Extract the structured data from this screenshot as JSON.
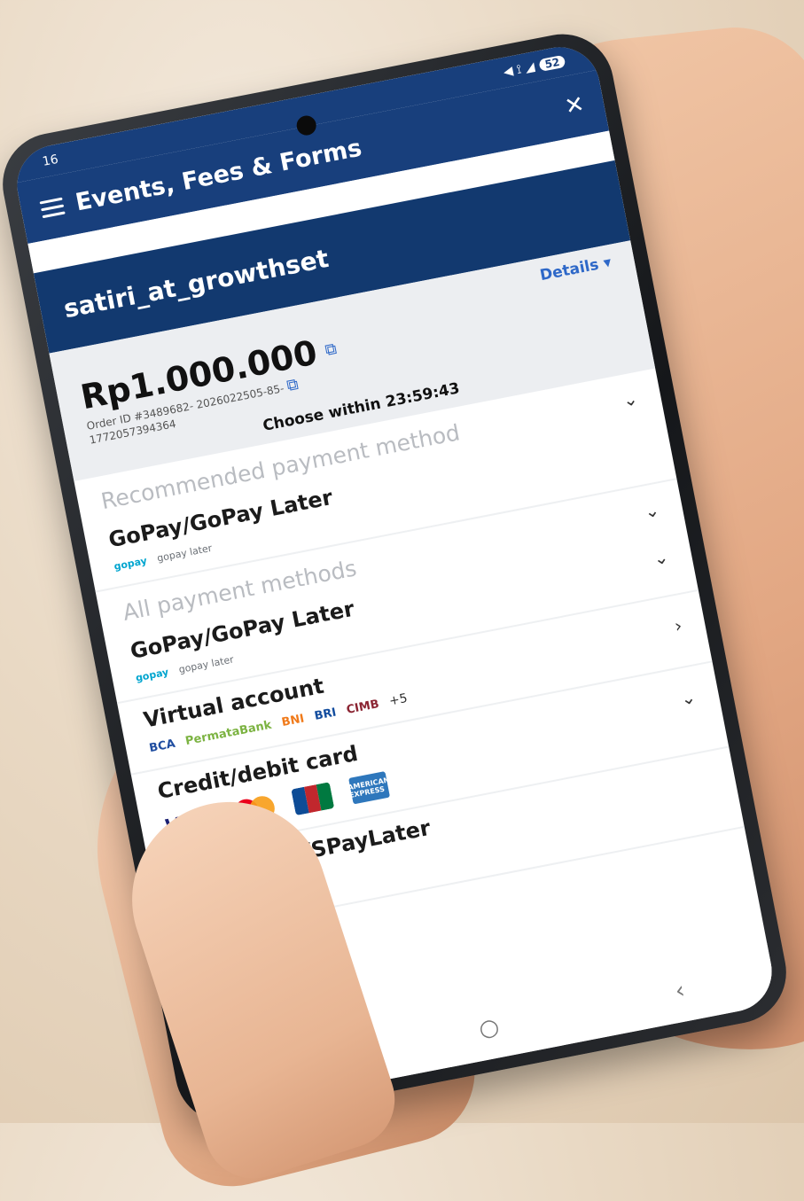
{
  "status_bar": {
    "time": "16",
    "battery": "52"
  },
  "app_bar": {
    "title": "Events, Fees & Forms"
  },
  "shop": {
    "name": "satiri_at_growthset"
  },
  "order": {
    "details_label": "Details ▾",
    "amount": "Rp1.000.000",
    "order_id_line1": "Order ID #3489682- 2026022505-85-",
    "order_id_line2": "1772057394364",
    "countdown": "Choose within 23:59:43"
  },
  "recommended": {
    "title": "Recommended payment method",
    "items": [
      {
        "name": "GoPay/GoPay Later",
        "logo1": "gopay",
        "logo2": "gopay later"
      }
    ]
  },
  "all_methods": {
    "title": "All payment methods",
    "gopay": {
      "name": "GoPay/GoPay Later",
      "logo1": "gopay",
      "logo2": "gopay later"
    },
    "virtual_account": {
      "name": "Virtual account",
      "banks": [
        "BCA",
        "PermataBank",
        "BNI",
        "BRI",
        "CIMB"
      ],
      "more": "+5"
    },
    "card": {
      "name": "Credit/debit card",
      "brands": {
        "visa": "VISA",
        "amex": "AMERICAN EXPRESS"
      }
    },
    "shopeepay": {
      "name": "ShopeePay/SPayLater"
    }
  },
  "nav": {
    "back": "‹",
    "home": "○",
    "recents": "|||"
  },
  "icons": {
    "menu": "hamburger-icon",
    "close": "close-icon",
    "copy": "copy-icon",
    "chevron": "chevron-down-icon"
  },
  "colors": {
    "header": "#183f7c",
    "accent": "#2e68c8"
  }
}
